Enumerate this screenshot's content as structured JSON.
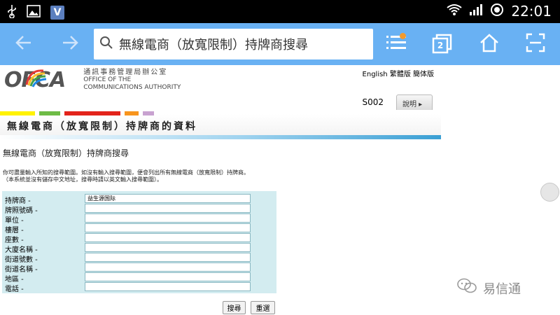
{
  "status_bar": {
    "time": "22:01",
    "app_badge": "V"
  },
  "browser": {
    "url_text": "無線電商（放寬限制）持牌商搜尋",
    "tabs_count": "2",
    "colors": {
      "toolbar": "#69b1f3",
      "notification_dot": "#f39a2c"
    }
  },
  "header": {
    "logo": "OFCA",
    "org_cn": "通訊事務管理局辦公室",
    "org_en_1": "OFFICE OF THE",
    "org_en_2": "COMMUNICATIONS AUTHORITY",
    "languages": "English 繁體版 簡体版",
    "page_code": "S002",
    "help_label": "說明 ▸"
  },
  "banner": {
    "title": "無線電商（放寬限制）持牌商的資料"
  },
  "section": {
    "title": "無線電商（放寬限制）持牌商搜尋",
    "note_1": "你可盡量輸入所知的搜尋範圍。如沒有輸入搜尋範圍，便會列出所有無線電商（放寬限制）持牌商。",
    "note_2": "（本系統並沒有儲存中文地址，搜尋時請以英文輸入搜尋範圍）。"
  },
  "form": {
    "fields": [
      {
        "label": "持牌商 -",
        "value": "益生源国际"
      },
      {
        "label": "牌照號碼 -",
        "value": ""
      },
      {
        "label": "單位 -",
        "value": ""
      },
      {
        "label": "樓層 -",
        "value": ""
      },
      {
        "label": "座數 -",
        "value": ""
      },
      {
        "label": "大廈名稱 -",
        "value": ""
      },
      {
        "label": "街道號數 -",
        "value": ""
      },
      {
        "label": "街道名稱 -",
        "value": ""
      },
      {
        "label": "地區 -",
        "value": ""
      },
      {
        "label": "電話 -",
        "value": ""
      }
    ],
    "search_label": "搜尋",
    "reset_label": "重選"
  },
  "watermark": {
    "text": "易信通"
  }
}
